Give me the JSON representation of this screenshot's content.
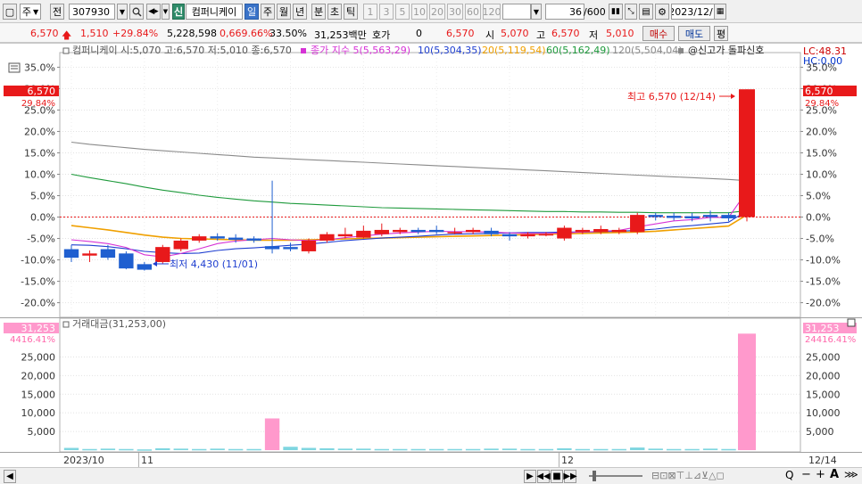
{
  "toolbar": {
    "mode_label": "주",
    "jeon_label": "전",
    "code_value": "307930",
    "shin_label": "신",
    "stock_name": "컴퍼니케이",
    "periods": [
      "일",
      "주",
      "월",
      "년",
      "분",
      "초",
      "틱"
    ],
    "active_period": "일",
    "intervals": [
      "1",
      "3",
      "5",
      "10",
      "20",
      "30",
      "60",
      "120"
    ],
    "count_value": "36",
    "count_max": "/600",
    "date_value": "2023/12/14"
  },
  "quote": {
    "price": "6,570",
    "change": "1,510",
    "change_pct": "+29.84%",
    "volume": "5,228,598",
    "vol_pct": "0,669.66%",
    "turnover": "33.50%",
    "amount": "31,253백만",
    "hoga_label": "호가",
    "hoga_value": "0",
    "hoga_price": "6,570",
    "open_label": "시",
    "open_value": "5,070",
    "high_label": "고",
    "high_value": "6,570",
    "low_label": "저",
    "low_value": "5,010",
    "buy_label": "매수",
    "sell_label": "매도",
    "flat_label": "평"
  },
  "legend": {
    "main": "컴퍼니케이 시:5,070 고:6,570 저:5,010 종:6,570",
    "ma_title": "종가 지수 5(5,563,29)",
    "ma10": "10(5,304,35)",
    "ma20": "20(5,119,54)",
    "ma60": "60(5,162,49)",
    "ma120": "120(5,504,04)",
    "signal": "@신고가 돌파신호",
    "lc": "LC:48.31",
    "hc": "HC:0.00",
    "volume_title": "거래대금(31,253,00)"
  },
  "annotations": {
    "high": "최고 6,570 (12/14)",
    "low": "최저 4,430 (11/01)"
  },
  "axis": {
    "price_ticks": [
      "35.0%",
      "30.0%",
      "25.0%",
      "20.0%",
      "15.0%",
      "10.0%",
      "5.0%",
      "0.0%",
      "-5.0%",
      "-10.0%",
      "-15.0%",
      "-20.0%"
    ],
    "right_ticks": [
      "35.0%",
      "30.0%",
      "25.0%",
      "20.0%",
      "15.0%",
      "10.0%",
      "5.0%",
      "0.0%",
      "-5.0%",
      "-10.0%",
      "-15.0%",
      "-20.0%"
    ],
    "price_tag": "6,570",
    "price_tag_pct": "29.84%",
    "vol_ticks": [
      "25,000",
      "20,000",
      "15,000",
      "10,000",
      "5,000"
    ],
    "vol_tag": "31,253",
    "vol_tag_pct_left": "4416.41%",
    "vol_tag_pct_right": "24416.41%",
    "x_labels": [
      "2023/10",
      "11",
      "12"
    ],
    "last_date": "12/14"
  },
  "colors": {
    "up": "#e8191a",
    "down": "#1f5fd0",
    "ma5": "#d633d6",
    "ma10": "#1f3fd0",
    "ma20": "#f0a000",
    "ma60": "#1e9a3c",
    "ma120": "#8a8a8a",
    "volume": "#ff99cc"
  },
  "chart_data": {
    "type": "candlestick",
    "y_unit": "% from 6,570 reference base",
    "ylim": [
      -23,
      38
    ],
    "candles": [
      {
        "o": -7.5,
        "c": -9.5,
        "h": -6.5,
        "l": -10.5
      },
      {
        "o": -9.0,
        "c": -8.5,
        "h": -7.8,
        "l": -10.5
      },
      {
        "o": -7.5,
        "c": -9.5,
        "h": -6.5,
        "l": -10.0
      },
      {
        "o": -8.5,
        "c": -12.0,
        "h": -8.0,
        "l": -12.2
      },
      {
        "o": -11.0,
        "c": -12.3,
        "h": -10.5,
        "l": -12.5
      },
      {
        "o": -10.5,
        "c": -7.0,
        "h": -6.5,
        "l": -11.0
      },
      {
        "o": -7.5,
        "c": -5.5,
        "h": -5.0,
        "l": -8.0
      },
      {
        "o": -5.5,
        "c": -4.5,
        "h": -4.0,
        "l": -6.0
      },
      {
        "o": -4.5,
        "c": -5.0,
        "h": -3.8,
        "l": -5.5
      },
      {
        "o": -4.8,
        "c": -5.3,
        "h": -4.0,
        "l": -6.0
      },
      {
        "o": -5.0,
        "c": -5.5,
        "h": -4.5,
        "l": -6.0
      },
      {
        "o": -6.8,
        "c": -7.5,
        "h": 8.5,
        "l": -8.5
      },
      {
        "o": -7.0,
        "c": -7.5,
        "h": -6.0,
        "l": -8.0
      },
      {
        "o": -8.0,
        "c": -5.5,
        "h": -5.0,
        "l": -8.5
      },
      {
        "o": -5.5,
        "c": -4.0,
        "h": -3.5,
        "l": -6.0
      },
      {
        "o": -4.5,
        "c": -4.0,
        "h": -2.5,
        "l": -5.0
      },
      {
        "o": -4.8,
        "c": -3.2,
        "h": -2.0,
        "l": -5.0
      },
      {
        "o": -4.0,
        "c": -3.0,
        "h": -1.5,
        "l": -4.5
      },
      {
        "o": -3.5,
        "c": -3.0,
        "h": -2.5,
        "l": -4.0
      },
      {
        "o": -3.0,
        "c": -3.5,
        "h": -2.5,
        "l": -4.0
      },
      {
        "o": -3.0,
        "c": -3.5,
        "h": -2.0,
        "l": -4.0
      },
      {
        "o": -3.5,
        "c": -3.5,
        "h": -2.5,
        "l": -4.0
      },
      {
        "o": -3.5,
        "c": -3.0,
        "h": -2.5,
        "l": -4.0
      },
      {
        "o": -3.2,
        "c": -4.0,
        "h": -2.5,
        "l": -4.5
      },
      {
        "o": -4.0,
        "c": -4.5,
        "h": -3.5,
        "l": -5.5
      },
      {
        "o": -4.5,
        "c": -4.0,
        "h": -3.5,
        "l": -5.0
      },
      {
        "o": -4.0,
        "c": -4.0,
        "h": -3.5,
        "l": -4.5
      },
      {
        "o": -5.0,
        "c": -2.5,
        "h": -2.0,
        "l": -5.5
      },
      {
        "o": -3.5,
        "c": -3.0,
        "h": -2.5,
        "l": -4.0
      },
      {
        "o": -3.5,
        "c": -2.8,
        "h": -2.0,
        "l": -4.0
      },
      {
        "o": -3.5,
        "c": -3.0,
        "h": -2.5,
        "l": -4.0
      },
      {
        "o": -3.5,
        "c": 0.5,
        "h": 1.0,
        "l": -4.0
      },
      {
        "o": 0.5,
        "c": 0.0,
        "h": 1.0,
        "l": -0.8
      },
      {
        "o": 0.3,
        "c": -0.2,
        "h": 1.0,
        "l": -0.8
      },
      {
        "o": 0.2,
        "c": -0.3,
        "h": 1.0,
        "l": -1.0
      },
      {
        "o": 0.5,
        "c": 0.0,
        "h": 1.5,
        "l": -1.0
      },
      {
        "o": 0.5,
        "c": -0.3,
        "h": 1.0,
        "l": -1.0
      },
      {
        "o": 0.0,
        "c": 29.84,
        "h": 29.84,
        "l": -1.0
      }
    ],
    "ma5": [
      -5.3,
      -5.7,
      -6.2,
      -7.1,
      -8.8,
      -9.3,
      -8.5,
      -7.4,
      -6.2,
      -5.6,
      -5.3,
      -5.0,
      -5.3,
      -5.5,
      -5.3,
      -4.8,
      -4.4,
      -4.0,
      -3.7,
      -3.5,
      -3.3,
      -3.4,
      -3.4,
      -3.5,
      -3.7,
      -3.8,
      -3.8,
      -3.7,
      -3.5,
      -3.3,
      -3.1,
      -2.3,
      -1.6,
      -0.9,
      -0.6,
      -0.1,
      -0.1,
      6.0
    ],
    "ma10": [
      -6.5,
      -6.6,
      -6.9,
      -7.4,
      -8.0,
      -8.3,
      -8.5,
      -8.4,
      -7.8,
      -7.4,
      -7.2,
      -6.9,
      -6.6,
      -6.3,
      -5.9,
      -5.5,
      -5.2,
      -4.9,
      -4.7,
      -4.5,
      -4.2,
      -4.0,
      -3.9,
      -3.8,
      -3.7,
      -3.6,
      -3.6,
      -3.5,
      -3.5,
      -3.4,
      -3.3,
      -3.1,
      -2.8,
      -2.3,
      -2.0,
      -1.6,
      -1.2,
      1.5
    ],
    "ma20": [
      -2.0,
      -2.5,
      -3.0,
      -3.6,
      -4.2,
      -4.7,
      -5.0,
      -5.1,
      -5.2,
      -5.3,
      -5.4,
      -5.4,
      -5.4,
      -5.3,
      -5.2,
      -5.1,
      -5.0,
      -4.9,
      -4.8,
      -4.7,
      -4.6,
      -4.5,
      -4.4,
      -4.3,
      -4.2,
      -4.1,
      -4.0,
      -3.9,
      -3.8,
      -3.7,
      -3.6,
      -3.5,
      -3.3,
      -3.0,
      -2.7,
      -2.4,
      -2.1,
      0.5
    ],
    "ma60": [
      10.0,
      9.2,
      8.5,
      7.8,
      7.0,
      6.3,
      5.7,
      5.1,
      4.6,
      4.2,
      3.8,
      3.5,
      3.2,
      3.0,
      2.8,
      2.6,
      2.4,
      2.2,
      2.1,
      2.0,
      1.9,
      1.8,
      1.7,
      1.6,
      1.5,
      1.4,
      1.3,
      1.3,
      1.2,
      1.2,
      1.1,
      1.1,
      1.0,
      1.0,
      1.0,
      1.0,
      1.0,
      1.5
    ],
    "ma120": [
      17.5,
      17.0,
      16.6,
      16.2,
      15.8,
      15.5,
      15.2,
      14.9,
      14.6,
      14.3,
      14.0,
      13.8,
      13.6,
      13.4,
      13.2,
      13.0,
      12.8,
      12.6,
      12.4,
      12.2,
      12.0,
      11.8,
      11.6,
      11.4,
      11.2,
      11.0,
      10.8,
      10.6,
      10.4,
      10.2,
      10.0,
      9.8,
      9.6,
      9.4,
      9.2,
      9.0,
      8.8,
      8.5
    ],
    "volume": [
      600,
      300,
      400,
      300,
      200,
      500,
      400,
      300,
      400,
      300,
      300,
      8500,
      900,
      600,
      500,
      400,
      400,
      300,
      300,
      300,
      300,
      300,
      300,
      400,
      400,
      300,
      300,
      500,
      300,
      300,
      300,
      700,
      400,
      300,
      300,
      400,
      300,
      31253
    ],
    "vol_ylim": [
      0,
      33000
    ]
  }
}
